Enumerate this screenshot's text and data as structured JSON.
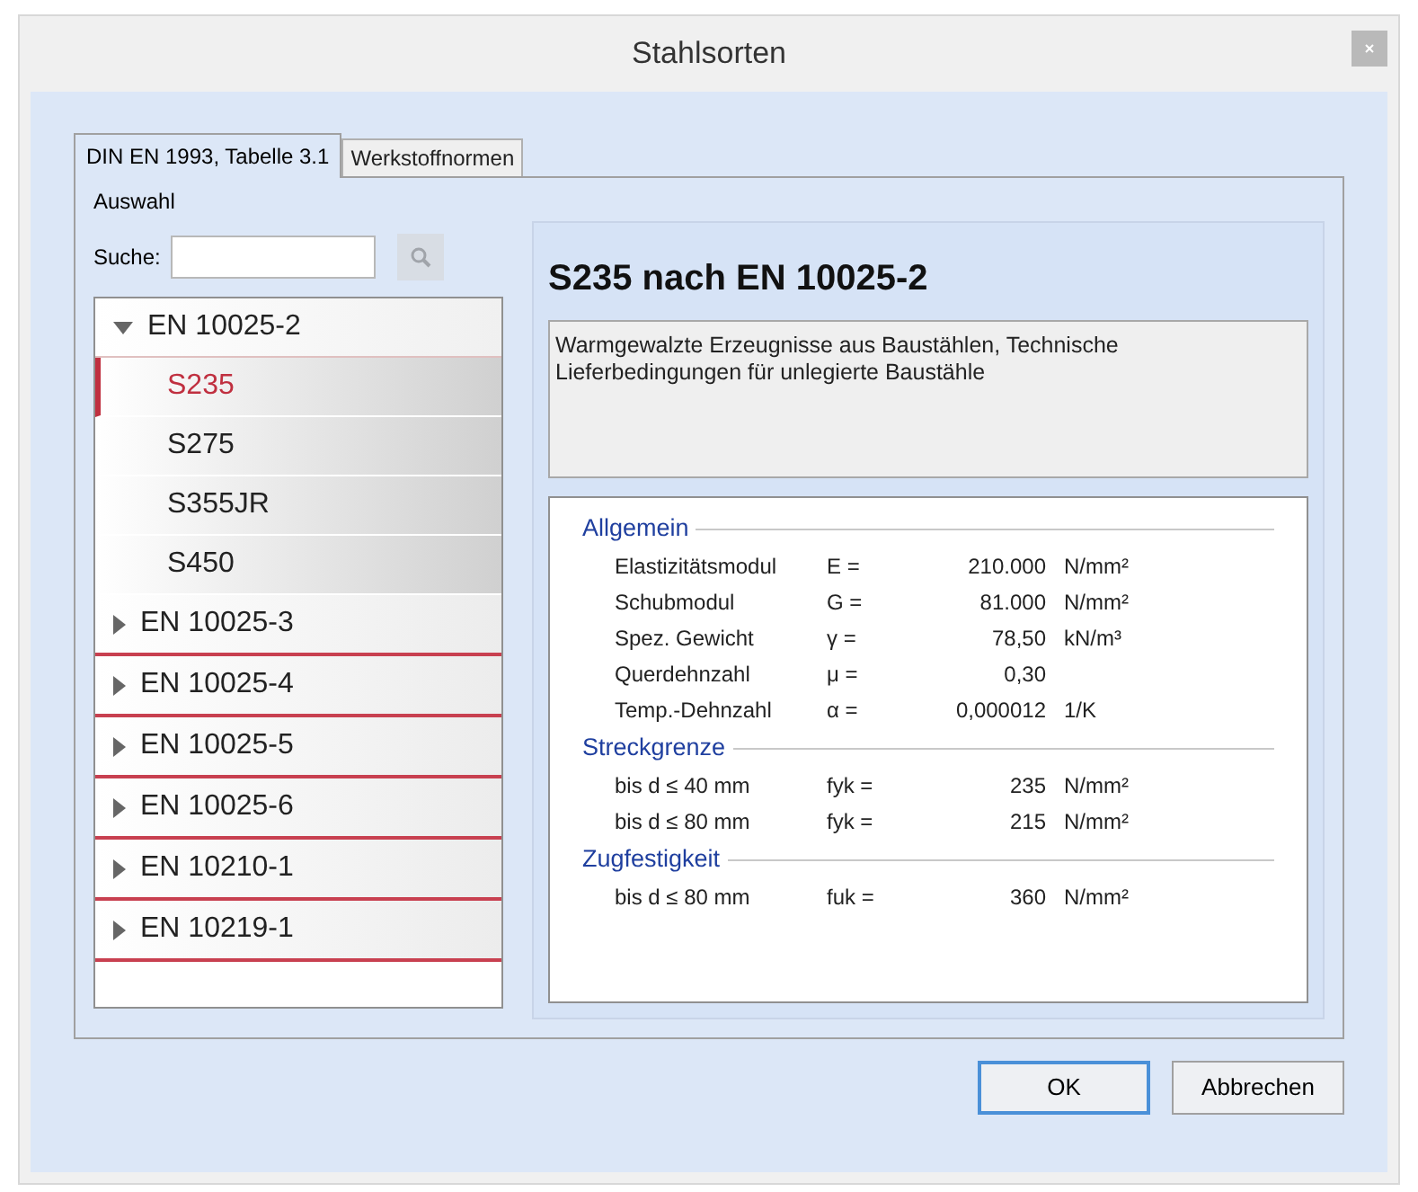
{
  "window": {
    "title": "Stahlsorten"
  },
  "tabs": [
    {
      "label": "DIN EN 1993, Tabelle 3.1",
      "selected": true
    },
    {
      "label": "Werkstoffnormen",
      "selected": false
    }
  ],
  "selection": {
    "title": "Auswahl",
    "search": {
      "label": "Suche:"
    },
    "tree": [
      {
        "label": "EN 10025-2",
        "expanded": true,
        "children": [
          {
            "label": "S235",
            "selected": true
          },
          {
            "label": "S275",
            "selected": false
          },
          {
            "label": "S355JR",
            "selected": false
          },
          {
            "label": "S450",
            "selected": false
          }
        ]
      },
      {
        "label": "EN 10025-3",
        "expanded": false
      },
      {
        "label": "EN 10025-4",
        "expanded": false
      },
      {
        "label": "EN 10025-5",
        "expanded": false
      },
      {
        "label": "EN 10025-6",
        "expanded": false
      },
      {
        "label": "EN 10210-1",
        "expanded": false
      },
      {
        "label": "EN 10219-1",
        "expanded": false
      }
    ]
  },
  "detail": {
    "title": "S235 nach EN 10025-2",
    "description": "Warmgewalzte Erzeugnisse aus Baustählen, Technische Lieferbedingungen für unlegierte Baustähle",
    "sections": [
      {
        "title": "Allgemein",
        "rows": [
          {
            "name": "Elastizitätsmodul",
            "symbol": "E =",
            "value": "210.000",
            "unit": "N/mm²"
          },
          {
            "name": "Schubmodul",
            "symbol": "G =",
            "value": "81.000",
            "unit": "N/mm²"
          },
          {
            "name": "Spez. Gewicht",
            "symbol": "γ =",
            "value": "78,50",
            "unit": "kN/m³"
          },
          {
            "name": "Querdehnzahl",
            "symbol": "μ =",
            "value": "0,30"
          },
          {
            "name": "Temp.-Dehnzahl",
            "symbol": "α =",
            "value": "0,000012",
            "unit": "1/K"
          }
        ]
      },
      {
        "title": "Streckgrenze",
        "rows": [
          {
            "name": "bis d ≤ 40 mm",
            "symbol": "fyk =",
            "value": "235",
            "unit": "N/mm²"
          },
          {
            "name": "bis d ≤ 80 mm",
            "symbol": "fyk =",
            "value": "215",
            "unit": "N/mm²"
          }
        ]
      },
      {
        "title": "Zugfestigkeit",
        "rows": [
          {
            "name": "bis d ≤ 80 mm",
            "symbol": "fuk =",
            "value": "360",
            "unit": "N/mm²"
          }
        ]
      }
    ]
  },
  "buttons": [
    {
      "label": "OK",
      "default": true
    },
    {
      "label": "Abbrechen",
      "default": false
    }
  ]
}
